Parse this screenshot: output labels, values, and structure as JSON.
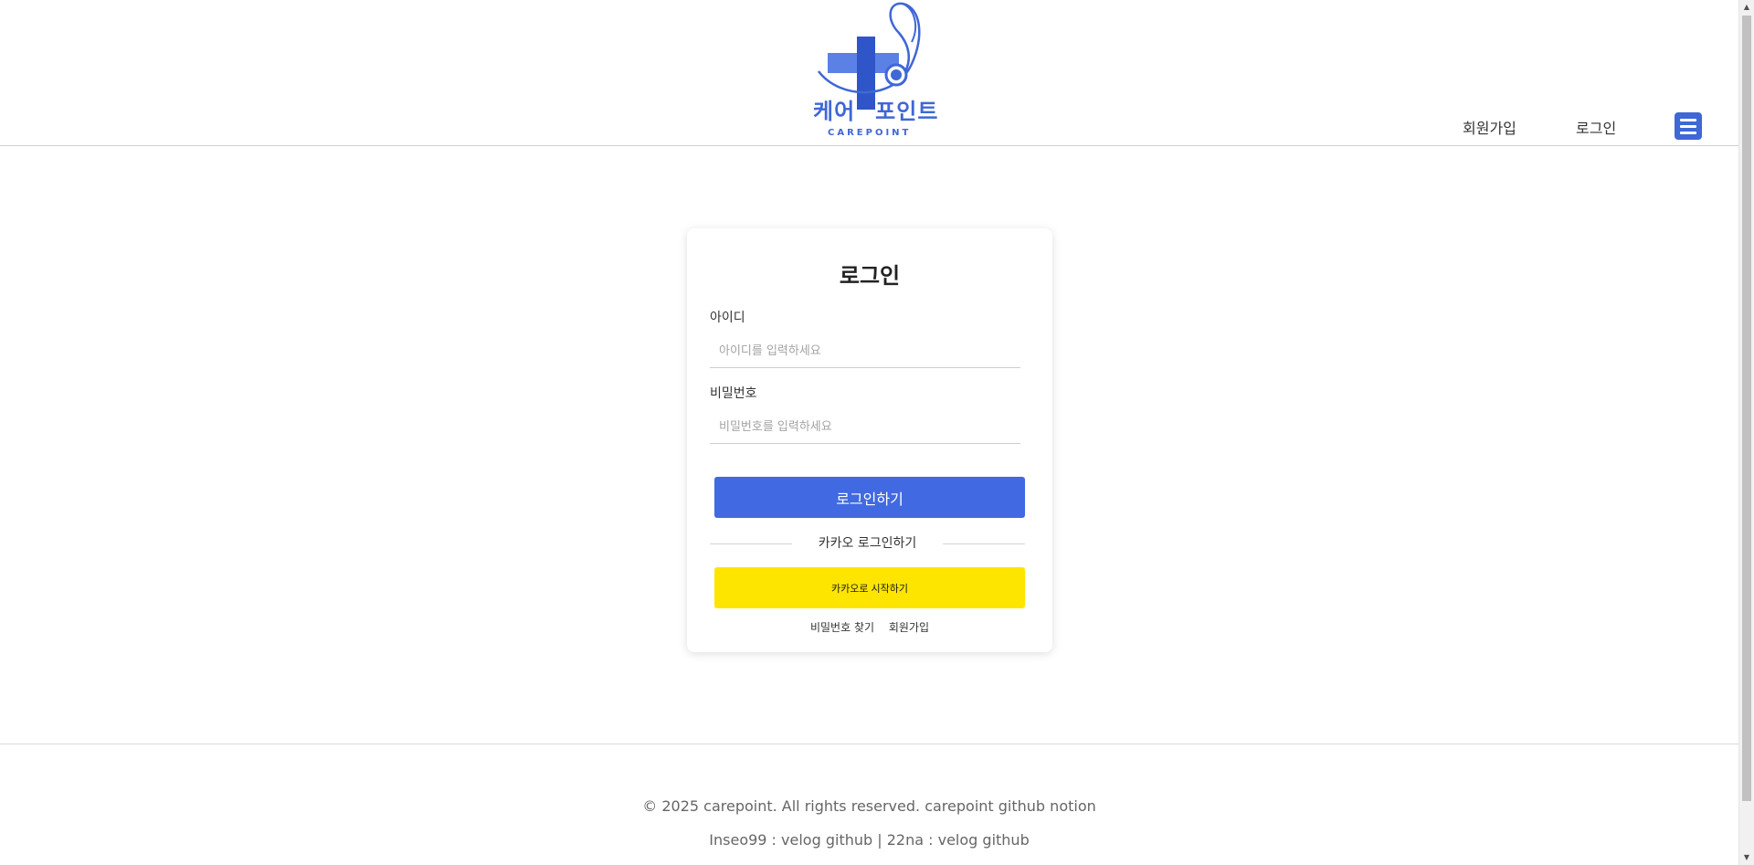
{
  "header": {
    "logo_kr_left": "케어",
    "logo_kr_right": "포인트",
    "logo_en": "CAREPOINT",
    "nav_signup": "회원가입",
    "nav_login": "로그인",
    "menu_icon": "hamburger-menu-icon",
    "brand_color": "#3f67d6"
  },
  "login": {
    "title": "로그인",
    "id_label": "아이디",
    "id_placeholder": "아이디를 입력하세요",
    "pw_label": "비밀번호",
    "pw_placeholder": "비밀번호를 입력하세요",
    "submit_label": "로그인하기",
    "submit_color": "#4169e1",
    "divider_text": "카카오 로그인하기",
    "kakao_label": "카카오로 시작하기",
    "kakao_color": "#fee500",
    "find_password": "비밀번호 찾기",
    "signup": "회원가입"
  },
  "footer": {
    "copyright": "© 2025 carepoint. All rights reserved.",
    "link_github": "carepoint github",
    "link_notion": "notion",
    "member1_name": "Inseo99 :",
    "member1_velog": "velog",
    "member1_github": "github",
    "separator": "|",
    "member2_name": "22na :",
    "member2_velog": "velog",
    "member2_github": "github"
  }
}
